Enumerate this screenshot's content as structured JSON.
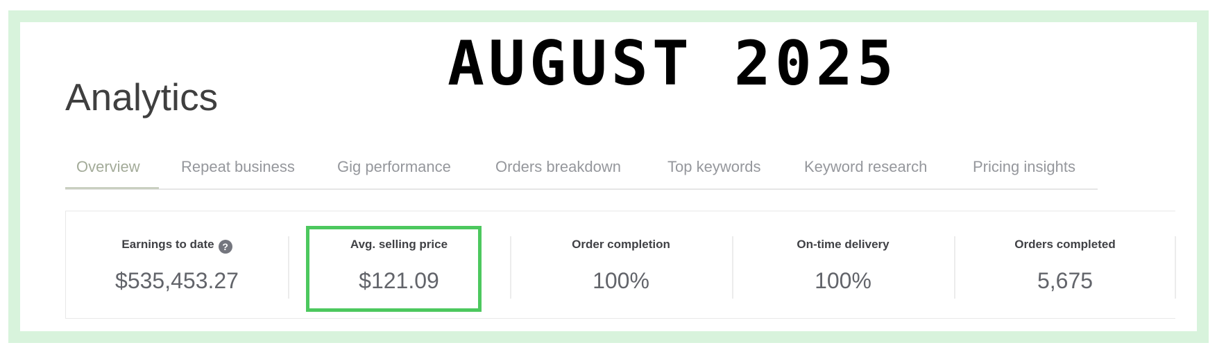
{
  "overlay": {
    "title": "AUGUST 2025",
    "highlight_color": "#4cc85e",
    "frame_color": "#d8f3dc"
  },
  "page": {
    "title": "Analytics"
  },
  "tabs": [
    {
      "label": "Overview",
      "active": true
    },
    {
      "label": "Repeat business",
      "active": false
    },
    {
      "label": "Gig performance",
      "active": false
    },
    {
      "label": "Orders breakdown",
      "active": false
    },
    {
      "label": "Top keywords",
      "active": false
    },
    {
      "label": "Keyword research",
      "active": false
    },
    {
      "label": "Pricing insights",
      "active": false
    }
  ],
  "stats": [
    {
      "label": "Earnings to date",
      "value": "$535,453.27",
      "icon": "question-mark-icon"
    },
    {
      "label": "Avg. selling price",
      "value": "$121.09",
      "highlighted": true
    },
    {
      "label": "Order completion",
      "value": "100%"
    },
    {
      "label": "On-time delivery",
      "value": "100%"
    },
    {
      "label": "Orders completed",
      "value": "5,675"
    }
  ],
  "icons": {
    "help_glyph": "?"
  }
}
